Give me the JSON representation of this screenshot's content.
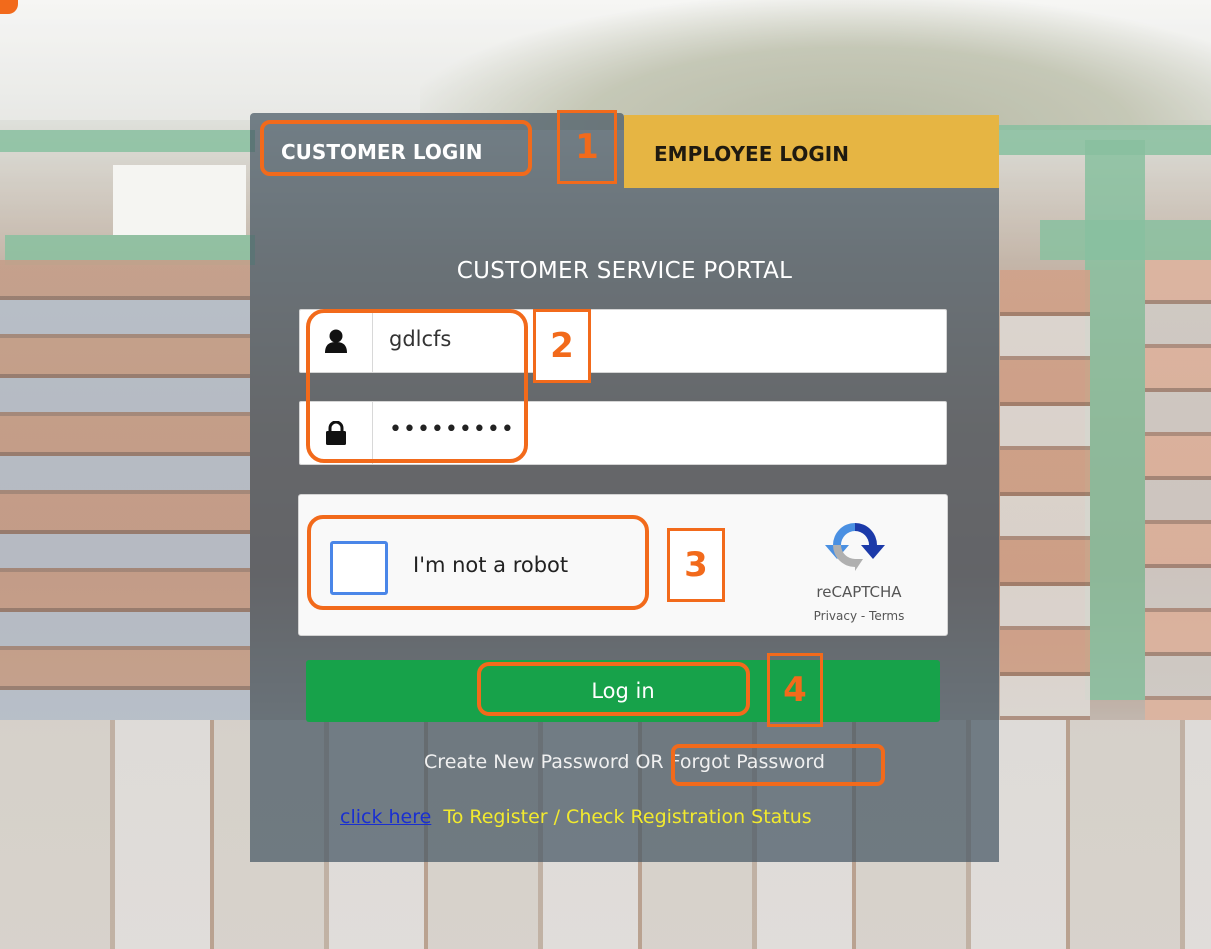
{
  "tabs": {
    "customer_label": "CUSTOMER LOGIN",
    "employee_label": "EMPLOYEE LOGIN"
  },
  "portal_title": "CUSTOMER SERVICE PORTAL",
  "form": {
    "username_value": "gdlcfs",
    "password_value": "•••••••••",
    "username_icon": "user-icon",
    "password_icon": "lock-icon"
  },
  "captcha": {
    "label": "I'm not a robot",
    "brand": "reCAPTCHA",
    "privacy": "Privacy",
    "separator": " - ",
    "terms": "Terms"
  },
  "login_button": "Log in",
  "links": {
    "create_password": "Create New Password OR ",
    "forgot_password": "Forgot Password",
    "click_here": "click here",
    "register_text": "To Register / Check Registration Status"
  },
  "annotations": {
    "step1": "1",
    "step2": "2",
    "step3": "3",
    "step4": "4",
    "color": "#f26a1b"
  },
  "colors": {
    "login_green": "#17a24a",
    "employee_tab": "#e6b543",
    "register_text": "#f2ea2e",
    "click_here": "#1a2fd0"
  }
}
